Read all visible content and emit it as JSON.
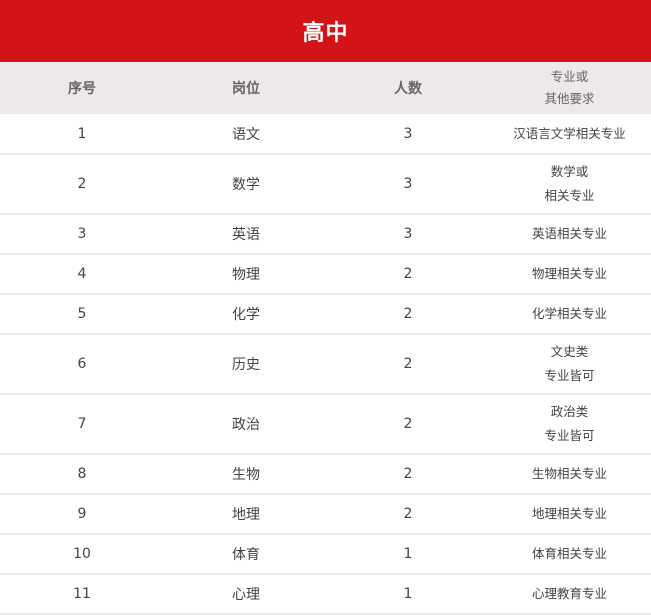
{
  "title": "高中",
  "headers": {
    "index": "序号",
    "position": "岗位",
    "count": "人数",
    "requirement_line1": "专业或",
    "requirement_line2": "其他要求"
  },
  "rows": [
    {
      "index": "1",
      "position": "语文",
      "count": "3",
      "req": [
        "汉语言文学相关专业"
      ]
    },
    {
      "index": "2",
      "position": "数学",
      "count": "3",
      "req": [
        "数学或",
        "相关专业"
      ]
    },
    {
      "index": "3",
      "position": "英语",
      "count": "3",
      "req": [
        "英语相关专业"
      ]
    },
    {
      "index": "4",
      "position": "物理",
      "count": "2",
      "req": [
        "物理相关专业"
      ]
    },
    {
      "index": "5",
      "position": "化学",
      "count": "2",
      "req": [
        "化学相关专业"
      ]
    },
    {
      "index": "6",
      "position": "历史",
      "count": "2",
      "req": [
        "文史类",
        "专业皆可"
      ]
    },
    {
      "index": "7",
      "position": "政治",
      "count": "2",
      "req": [
        "政治类",
        "专业皆可"
      ]
    },
    {
      "index": "8",
      "position": "生物",
      "count": "2",
      "req": [
        "生物相关专业"
      ]
    },
    {
      "index": "9",
      "position": "地理",
      "count": "2",
      "req": [
        "地理相关专业"
      ]
    },
    {
      "index": "10",
      "position": "体育",
      "count": "1",
      "req": [
        "体育相关专业"
      ]
    },
    {
      "index": "11",
      "position": "心理",
      "count": "1",
      "req": [
        "心理教育专业"
      ]
    }
  ],
  "colors": {
    "title_bg": "#d21317",
    "header_bg": "#ece8ec",
    "row_bg": "#ffffff",
    "divider": "#ece9ec"
  }
}
